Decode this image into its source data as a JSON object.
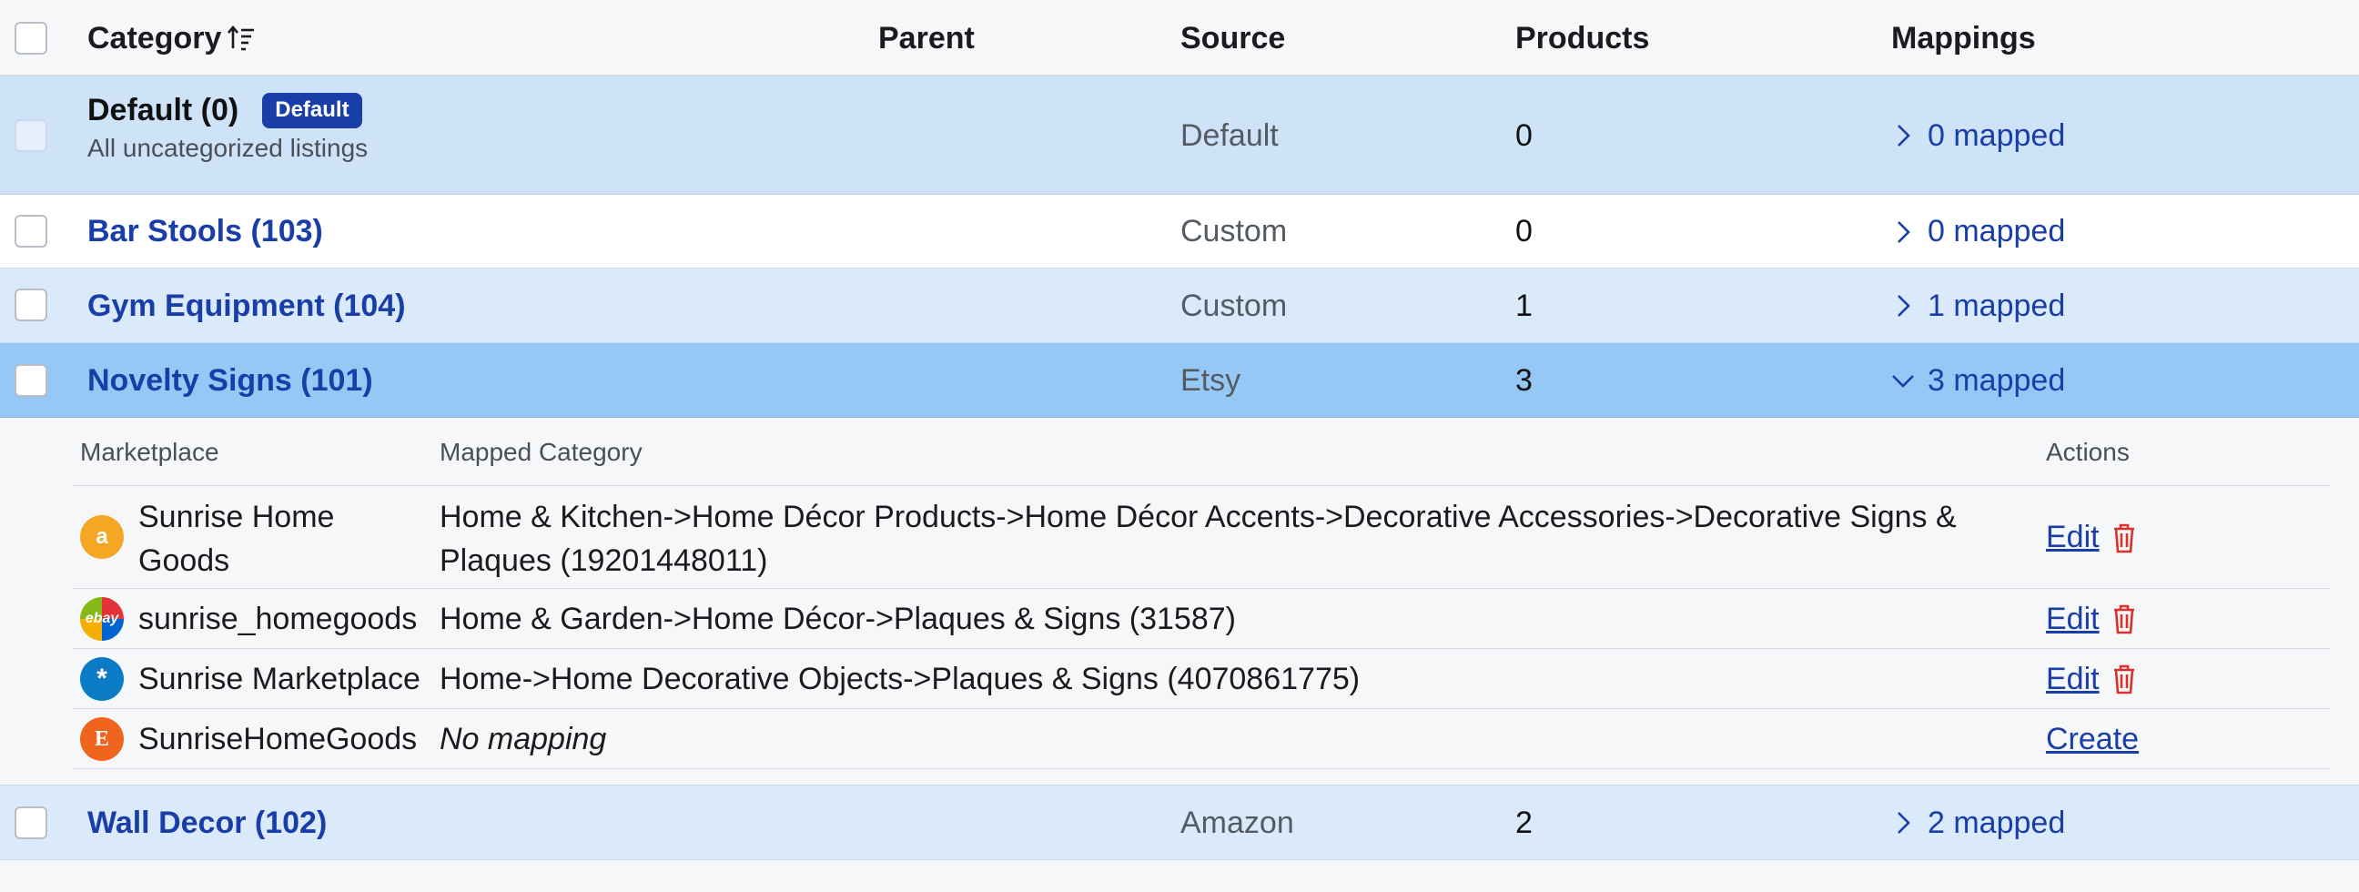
{
  "header": {
    "category": "Category",
    "parent": "Parent",
    "source": "Source",
    "products": "Products",
    "mappings": "Mappings"
  },
  "rows": [
    {
      "name": "Default (0)",
      "badge": "Default",
      "subtitle": "All uncategorized listings",
      "source": "Default",
      "products": "0",
      "mappings": "0 mapped"
    },
    {
      "name": "Bar Stools (103)",
      "source": "Custom",
      "products": "0",
      "mappings": "0 mapped"
    },
    {
      "name": "Gym Equipment (104)",
      "source": "Custom",
      "products": "1",
      "mappings": "1 mapped"
    },
    {
      "name": "Novelty Signs (101)",
      "source": "Etsy",
      "products": "3",
      "mappings": "3 mapped",
      "expanded": true
    },
    {
      "name": "Wall Decor (102)",
      "source": "Amazon",
      "products": "2",
      "mappings": "2 mapped"
    }
  ],
  "subtable": {
    "headers": {
      "marketplace": "Marketplace",
      "mapped_category": "Mapped Category",
      "actions": "Actions"
    },
    "rows": [
      {
        "marketplace_line1": "Sunrise Home",
        "marketplace_line2": "Goods",
        "icon": "amazon-icon",
        "icon_glyph": "a",
        "category_line1": "Home & Kitchen->Home Décor Products->Home Décor Accents->Decorative Accessories->Decorative Signs &",
        "category_line2": "Plaques (19201448011)",
        "action": "Edit"
      },
      {
        "marketplace": "sunrise_homegoods",
        "icon": "ebay-icon",
        "icon_glyph": "ebay",
        "category": "Home & Garden->Home Décor->Plaques & Signs (31587)",
        "action": "Edit"
      },
      {
        "marketplace": "Sunrise Marketplace",
        "icon": "walmart-icon",
        "icon_glyph": "*",
        "category": "Home->Home Decorative Objects->Plaques & Signs (4070861775)",
        "action": "Edit"
      },
      {
        "marketplace": "SunriseHomeGoods",
        "icon": "etsy-icon",
        "icon_glyph": "E",
        "category": "No mapping",
        "action": "Create"
      }
    ]
  },
  "colors": {
    "link": "#1a3ea8",
    "badge": "#1a3ea8",
    "row_selected": "#96c8f5",
    "row_alt": "#dbeafa",
    "trash": "#d9322b"
  }
}
